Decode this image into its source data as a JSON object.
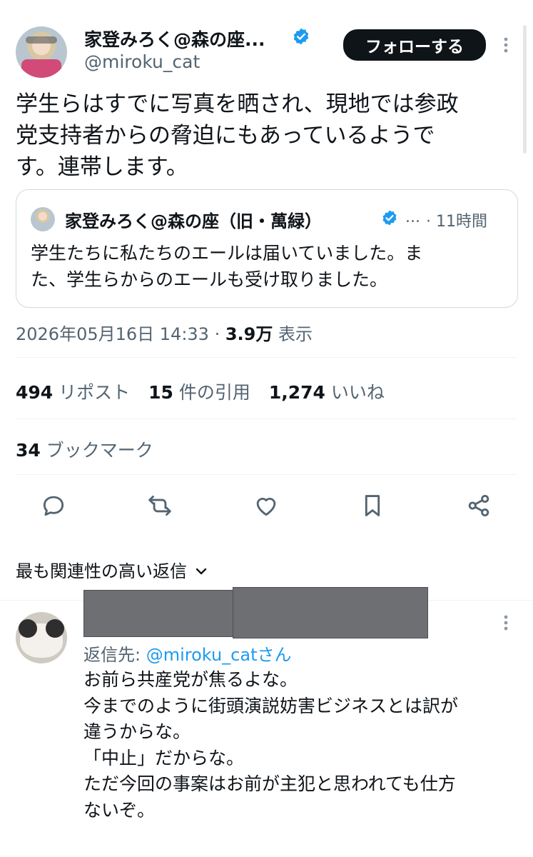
{
  "tweet": {
    "author_name": "家登みろく@森の座...",
    "author_handle": "@miroku_cat",
    "follow_label": "フォローする",
    "text_lines": [
      "学生らはすでに写真を晒され、現地では参政",
      "党支持者からの脅迫にもあっているようで",
      "す。連帯します。"
    ],
    "quote": {
      "author_name": "家登みろく@森の座（旧・萬緑）",
      "ellipsis": "...",
      "time": "· 11時間",
      "text_lines": [
        "学生たちに私たちのエールは届いていました。ま",
        "た、学生らからのエールも受け取りました。"
      ]
    },
    "timestamp": "2026年05月16日 14:33 · ",
    "views_count": "3.9万",
    "views_label": " 表示",
    "stats": [
      {
        "count": "494",
        "label": "リポスト"
      },
      {
        "count": "15",
        "label": "件の引用"
      },
      {
        "count": "1,274",
        "label": "いいね"
      }
    ],
    "bookmarks": {
      "count": "34",
      "label": "ブックマーク"
    },
    "actions": [
      "reply-icon",
      "retweet-icon",
      "heart-icon",
      "bookmark-icon",
      "share-icon"
    ]
  },
  "replies_header": {
    "label": "最も関連性の高い返信",
    "chevron": "⌄"
  },
  "reply": {
    "reply_to_prefix": "返信先: ",
    "reply_to_handle": "@miroku_catさん",
    "text_lines": [
      "お前ら共産党が焦るよな。",
      "今までのように街頭演説妨害ビジネスとは訳が",
      "違うからな。",
      "「中止」だからな。",
      "ただ今回の事案はお前が主犯と思われても仕方",
      "ないぞ。"
    ]
  },
  "colors": {
    "accent": "#1d9bf0",
    "text": "#0f1419",
    "muted": "#536471",
    "redaction": "#6e6f73"
  }
}
